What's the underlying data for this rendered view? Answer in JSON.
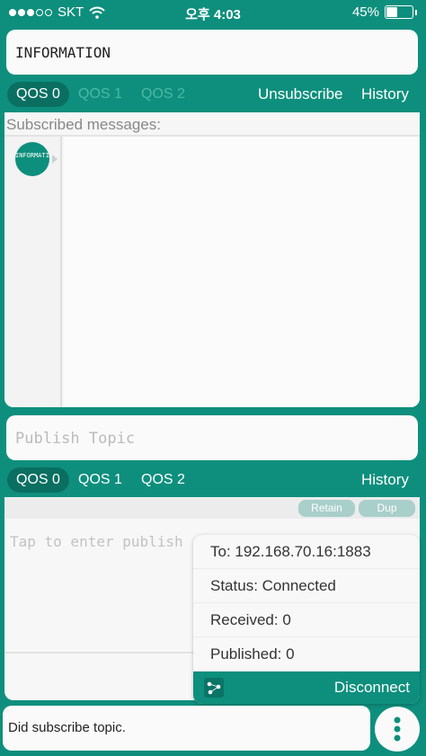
{
  "status_bar": {
    "carrier": "SKT",
    "time": "오후 4:03",
    "battery_percent": "45%",
    "battery_level": 0.45
  },
  "subscribe": {
    "topic_value": "INFORMATION",
    "qos": [
      "QOS 0",
      "QOS 1",
      "QOS 2"
    ],
    "selected_qos": 0,
    "unsubscribe_label": "Unsubscribe",
    "history_label": "History",
    "messages_label": "Subscribed messages:",
    "topic_chip": "INFORMATION"
  },
  "publish": {
    "topic_placeholder": "Publish Topic",
    "qos": [
      "QOS 0",
      "QOS 1",
      "QOS 2"
    ],
    "selected_qos": 0,
    "history_label": "History",
    "retain_label": "Retain",
    "dup_label": "Dup",
    "message_placeholder": "Tap to enter publish"
  },
  "connection": {
    "to": "To: 192.168.70.16:1883",
    "status": "Status: Connected",
    "received": "Received: 0",
    "published": "Published: 0",
    "disconnect_label": "Disconnect"
  },
  "footer": {
    "status_message": "Did subscribe topic."
  },
  "colors": {
    "accent": "#0e8f7d",
    "accent_dark": "#0a6f61",
    "panel": "#f6f6f6"
  }
}
